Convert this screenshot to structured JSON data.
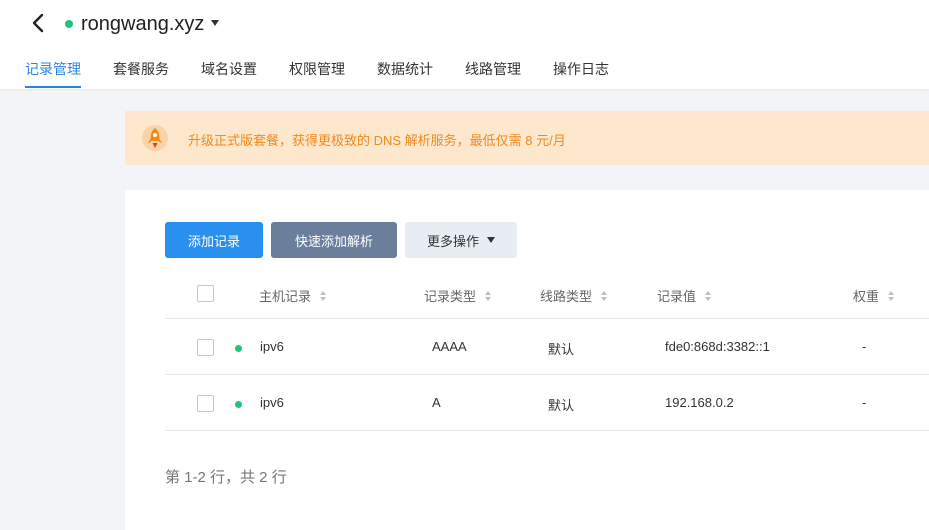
{
  "header": {
    "domain": "rongwang.xyz",
    "tabs": [
      {
        "label": "记录管理",
        "active": true
      },
      {
        "label": "套餐服务",
        "active": false
      },
      {
        "label": "域名设置",
        "active": false
      },
      {
        "label": "权限管理",
        "active": false
      },
      {
        "label": "数据统计",
        "active": false
      },
      {
        "label": "线路管理",
        "active": false
      },
      {
        "label": "操作日志",
        "active": false
      }
    ]
  },
  "banner": {
    "text": "升级正式版套餐，获得更极致的 DNS 解析服务，最低仅需 8 元/月"
  },
  "toolbar": {
    "add_label": "添加记录",
    "quick_add_label": "快速添加解析",
    "more_label": "更多操作"
  },
  "table": {
    "columns": [
      "主机记录",
      "记录类型",
      "线路类型",
      "记录值",
      "权重"
    ],
    "rows": [
      {
        "host": "ipv6",
        "type": "AAAA",
        "line": "默认",
        "value": "fde0:868d:3382::1",
        "weight": "-"
      },
      {
        "host": "ipv6",
        "type": "A",
        "line": "默认",
        "value": "192.168.0.2",
        "weight": "-"
      }
    ]
  },
  "pagination": {
    "summary": "第 1-2 行，共 2 行"
  },
  "colors": {
    "accent": "#2a84e8",
    "primary_button": "#2a90f0",
    "secondary_button": "#6b7f9d",
    "status_ok": "#1ec47a",
    "banner_bg": "#fde7cd",
    "banner_text": "#f08a1d"
  },
  "icons": {
    "back": "chevron-left-icon",
    "domain_dropdown": "caret-down-icon",
    "banner": "rocket-icon",
    "sort": "sort-icon"
  }
}
